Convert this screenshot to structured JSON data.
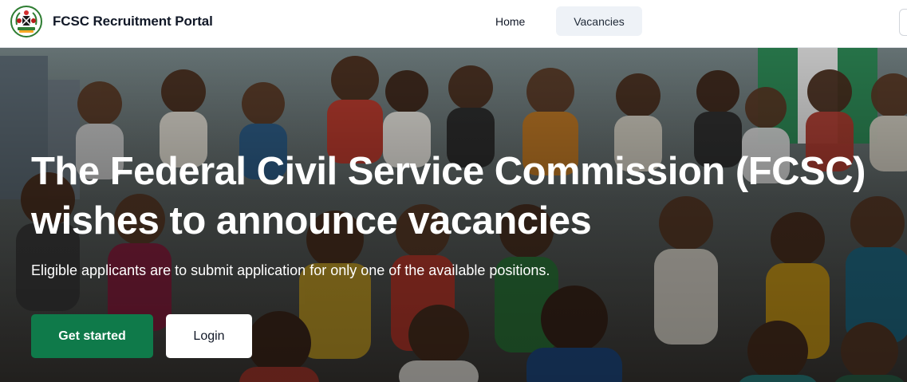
{
  "header": {
    "brand": "FCSC Recruitment Portal",
    "logo_icon": "nigeria-coat-of-arms-icon",
    "nav": {
      "home": "Home",
      "vacancies": "Vacancies"
    }
  },
  "hero": {
    "headline_line1": "The Federal Civil Service Commission (FCSC)",
    "headline_line2": "wishes to announce vacancies",
    "subtext": "Eligible applicants are to submit application for only one of the available positions.",
    "background_image": "crowd-of-nigerian-professionals-image",
    "buttons": {
      "get_started": "Get started",
      "login": "Login"
    }
  },
  "colors": {
    "primary_green": "#0f7a4a",
    "active_nav_bg": "#eef2f7",
    "text_dark": "#111827"
  }
}
